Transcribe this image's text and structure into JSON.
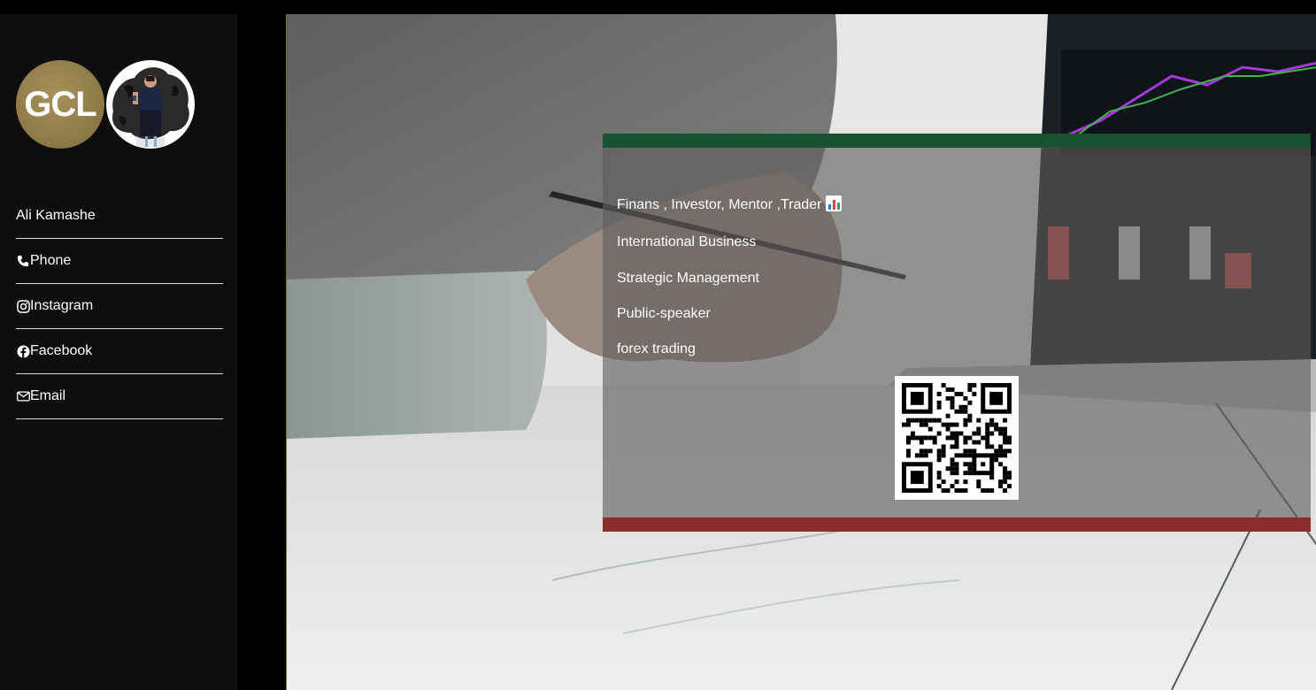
{
  "sidebar": {
    "logo_text": "GCL",
    "avatar": "profile-photo",
    "items": [
      {
        "label": "Ali Kamashe",
        "icon": ""
      },
      {
        "label": "Phone",
        "icon": "phone-icon"
      },
      {
        "label": "Instagram",
        "icon": "instagram-icon"
      },
      {
        "label": "Facebook",
        "icon": "facebook-icon"
      },
      {
        "label": "Email",
        "icon": "mail-icon"
      }
    ]
  },
  "card": {
    "lines": [
      "Finans , Investor, Mentor ,Trader",
      "International Business",
      "Strategic Management",
      "Public-speaker",
      "forex trading"
    ],
    "title_emoji": "chart-icon",
    "qr": "qr-code"
  },
  "colors": {
    "sidebar_bg": "#0e0e0e",
    "card_top": "#175330",
    "card_bottom": "#8b2d2d",
    "logo_gold": "#8d7a48"
  }
}
